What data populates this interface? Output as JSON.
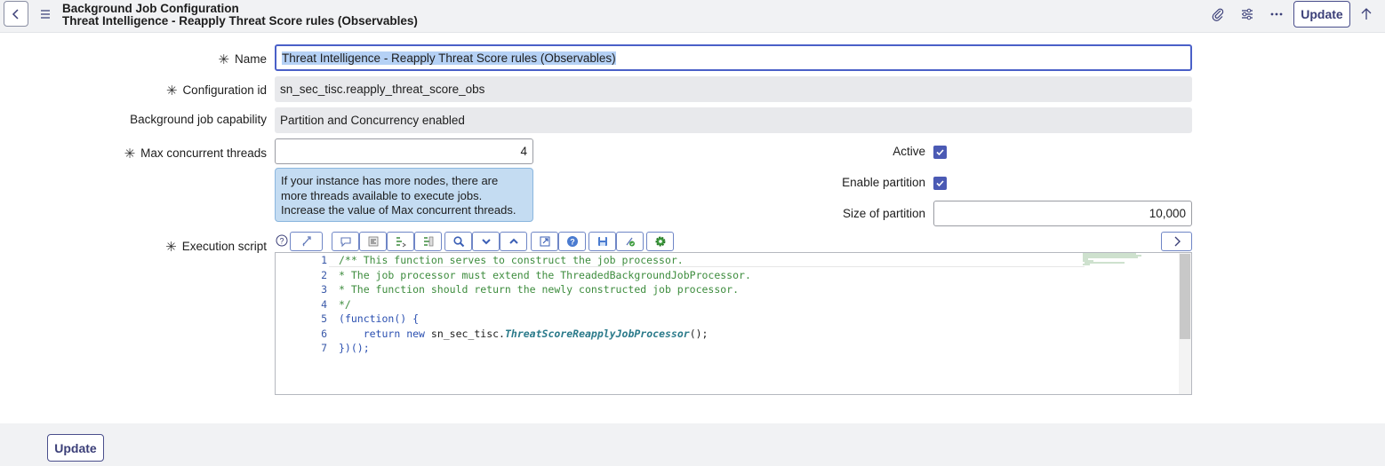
{
  "header": {
    "title": "Background Job Configuration",
    "subtitle": "Threat Intelligence - Reapply Threat Score rules (Observables)",
    "update_label": "Update",
    "icons": [
      "back-icon",
      "menu-icon",
      "paperclip-icon",
      "settings-sliders-icon",
      "more-icon",
      "arrow-up-icon"
    ]
  },
  "form": {
    "name_label": "Name",
    "name_value": "Threat Intelligence - Reapply Threat Score rules (Observables)",
    "config_id_label": "Configuration id",
    "config_id_value": "sn_sec_tisc.reapply_threat_score_obs",
    "capability_label": "Background job capability",
    "capability_value": "Partition and Concurrency enabled",
    "max_threads_label": "Max concurrent threads",
    "max_threads_value": "4",
    "info_text": "If your instance has more nodes, there are more threads available to execute jobs. Increase the value of Max concurrent threads.",
    "active_label": "Active",
    "active_checked": true,
    "enable_partition_label": "Enable partition",
    "enable_partition_checked": true,
    "size_partition_label": "Size of partition",
    "size_partition_value": "10,000",
    "script_label": "Execution script"
  },
  "editor": {
    "line_numbers": [
      "1",
      "2",
      "3",
      "4",
      "5",
      "6",
      "7"
    ],
    "lines": [
      "/** This function serves to construct the job processor.",
      "* The job processor must extend the ThreadedBackgroundJobProcessor.",
      "* The function should return the newly constructed job processor.",
      "*/",
      "(function() {",
      "    return new sn_sec_tisc.ThreatScoreReapplyJobProcessor();",
      "})();"
    ],
    "toolbar_icons": [
      "script-include-icon",
      "comment-icon",
      "format-icon",
      "replace-icon",
      "replace-all-icon",
      "search-icon",
      "collapse-icon",
      "expand-icon",
      "open-new-icon",
      "help-icon",
      "save-icon",
      "script-debugger-icon",
      "settings-gear-icon"
    ]
  },
  "footer": {
    "update_label": "Update"
  },
  "colors": {
    "accent": "#3b3f78",
    "checkbox": "#4b5ab4",
    "info_bg": "#c4dcf2",
    "readonly_bg": "#e8e9ec"
  }
}
